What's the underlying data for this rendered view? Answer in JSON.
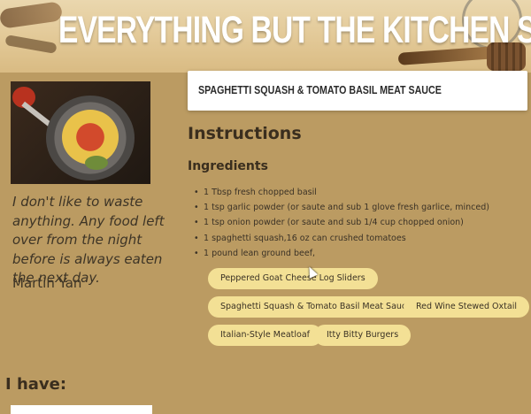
{
  "header": {
    "title": "EVERYTHING BUT THE KITCHEN SINK"
  },
  "sidebar": {
    "quote": "I don't like to waste anything. Any food left over from the night before is always eaten the next day.",
    "author": "Martin Yan"
  },
  "recipe": {
    "title": "SPAGHETTI SQUASH & TOMATO BASIL MEAT SAUCE",
    "instructions_heading": "Instructions",
    "ingredients_heading": "Ingredients",
    "ingredients": [
      "1 Tbsp fresh chopped basil",
      "1 tsp garlic powder (or saute and sub 1 glove fresh garlice, minced)",
      "1 tsp onion powder (or saute and sub 1/4 cup chopped onion)",
      "1 spaghetti squash,16 oz can crushed tomatoes",
      "1 pound lean ground beef,"
    ]
  },
  "recipe_chips": [
    "Peppered Goat Cheese Log Sliders",
    "Spaghetti Squash & Tomato Basil Meat Sauce",
    "Red Wine Stewed Oxtail",
    "Italian-Style Meatloaf",
    "Itty Bitty Burgers"
  ],
  "pantry": {
    "heading": "I have:"
  },
  "colors": {
    "background": "#bb9b62",
    "chip": "#f3e095",
    "card": "#ffffff"
  }
}
